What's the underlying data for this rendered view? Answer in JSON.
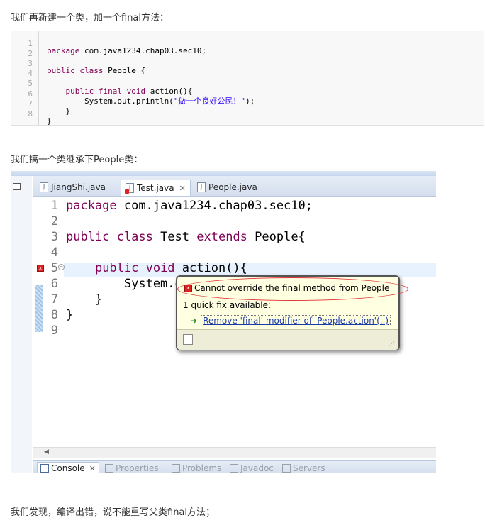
{
  "article": {
    "para1": "我们再新建一个类，加一个final方法：",
    "para2": "我们搞一个类继承下People类：",
    "para3": "我们发现，编译出错，说不能重写父类final方法；"
  },
  "codeblock": {
    "line_numbers": [
      "1",
      "2",
      "3",
      "4",
      "5",
      "6",
      "7",
      "8"
    ],
    "lines": {
      "l2_kw": "package",
      "l2_rest": " com.java1234.chap03.sec10;",
      "l4_kw": "public class",
      "l4_rest": " People {",
      "l6_indent": "    ",
      "l6_kw": "public final void",
      "l6_rest": " action(){",
      "l7_a": "        System.out.println(",
      "l7_str": "\"做一个良好公民！\"",
      "l7_b": ");",
      "l8": "    }",
      "l9": "}"
    }
  },
  "eclipse": {
    "tabs": [
      {
        "label": "JiangShi.java"
      },
      {
        "label": "Test.java",
        "close": "✕"
      },
      {
        "label": "People.java"
      }
    ],
    "editor": {
      "line_numbers": [
        "1",
        "2",
        "3",
        "4",
        "5",
        "6",
        "7",
        "8",
        "9"
      ],
      "l1_kw": "package",
      "l1_rest": " com.java1234.chap03.sec10;",
      "l3_kw1": "public class",
      "l3_mid": " Test ",
      "l3_kw2": "extends",
      "l3_rest": " People{",
      "l5_indent": "    ",
      "l5_kw": "public void",
      "l5_rest": " action(){",
      "l6": "        System.o",
      "l7": "    }",
      "l8": "}"
    },
    "bottom_tabs": [
      {
        "label": "Console",
        "close": "✕"
      },
      {
        "label": "Properties"
      },
      {
        "label": "Problems"
      },
      {
        "label": "Javadoc"
      },
      {
        "label": "Servers"
      }
    ],
    "popup": {
      "message": "Cannot override the final method from People",
      "count": "1 quick fix available:",
      "fix": "Remove 'final' modifier of 'People.action'(..)"
    }
  },
  "colors": {
    "keyword": "#7f0055",
    "string": "#2a00ff",
    "popup_bg": "#ffffe1",
    "annotation_ellipse": "#dd3333"
  }
}
